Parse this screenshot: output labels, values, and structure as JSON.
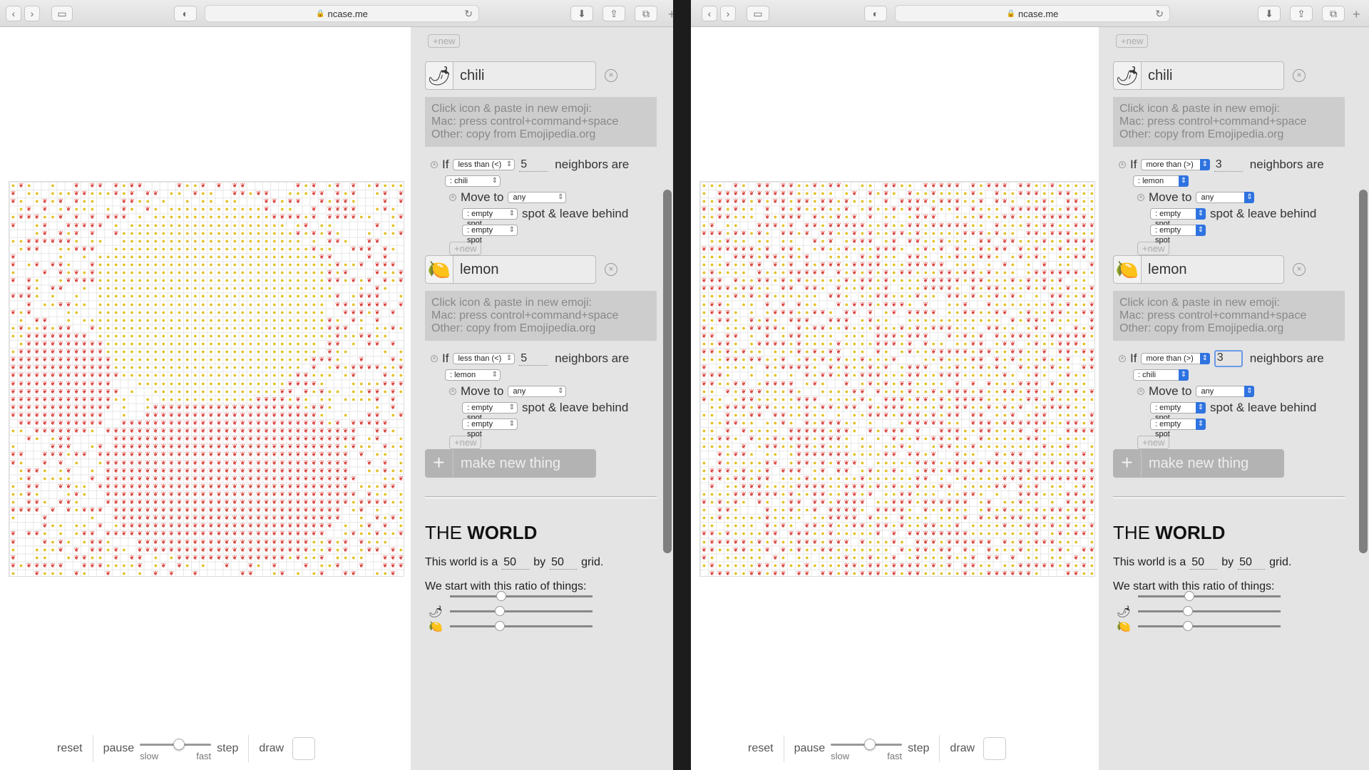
{
  "browser": {
    "url": "ncase.me",
    "lock_icon": "lock-icon",
    "reload_icon": "reload-icon"
  },
  "controls": {
    "reset": "reset",
    "pause": "pause",
    "slow": "slow",
    "fast": "fast",
    "step": "step",
    "draw": "draw",
    "speed_level": 0.55
  },
  "panes": [
    {
      "top_new": "+new",
      "things": [
        {
          "name": "chili",
          "emoji": "🌶",
          "hint_1": "Click icon & paste in new emoji:",
          "hint_2": "Mac: press control+command+space",
          "hint_3": "Other: copy from Emojipedia.org",
          "if_label": "If",
          "comparator": "less than (<)",
          "count": "5",
          "neighbors_label": "neighbors are",
          "neighbor_type": ": chili",
          "move_label": "Move to",
          "move_target": "any",
          "spot_select": ": empty spot",
          "leave_label": "spot & leave behind",
          "leave_select": ": empty spot",
          "inner_new": "+new",
          "outer_new": "+new"
        },
        {
          "name": "lemon",
          "emoji": "🍋",
          "hint_1": "Click icon & paste in new emoji:",
          "hint_2": "Mac: press control+command+space",
          "hint_3": "Other: copy from Emojipedia.org",
          "if_label": "If",
          "comparator": "less than (<)",
          "count": "5",
          "neighbors_label": "neighbors are",
          "neighbor_type": ": lemon",
          "move_label": "Move to",
          "move_target": "any",
          "spot_select": ": empty spot",
          "leave_label": "spot & leave behind",
          "leave_select": ": empty spot",
          "inner_new": "+new",
          "outer_new": "+new"
        }
      ],
      "make_new": "make new thing",
      "world_title_1": "THE ",
      "world_title_2": "WORLD",
      "world_line_a": "This world is a",
      "world_w": "50",
      "world_by": "by",
      "world_h": "50",
      "world_grid": "grid.",
      "ratio_label": "We start with this ratio of things:",
      "ratio_levels": [
        0.36,
        0.35,
        0.35
      ]
    },
    {
      "top_new": "+new",
      "things": [
        {
          "name": "chili",
          "emoji": "🌶",
          "hint_1": "Click icon & paste in new emoji:",
          "hint_2": "Mac: press control+command+space",
          "hint_3": "Other: copy from Emojipedia.org",
          "if_label": "If",
          "comparator": "more than (>)",
          "count": "3",
          "neighbors_label": "neighbors are",
          "neighbor_type": ": lemon",
          "move_label": "Move to",
          "move_target": "any",
          "spot_select": ": empty spot",
          "leave_label": "spot & leave behind",
          "leave_select": ": empty spot",
          "inner_new": "+new",
          "outer_new": "+new"
        },
        {
          "name": "lemon",
          "emoji": "🍋",
          "hint_1": "Click icon & paste in new emoji:",
          "hint_2": "Mac: press control+command+space",
          "hint_3": "Other: copy from Emojipedia.org",
          "if_label": "If",
          "comparator": "more than (>)",
          "count": "3",
          "neighbors_label": "neighbors are",
          "neighbor_type": ": chili",
          "move_label": "Move to",
          "move_target": "any",
          "spot_select": ": empty spot",
          "leave_label": "spot & leave behind",
          "leave_select": ": empty spot",
          "inner_new": "+new",
          "outer_new": "+new"
        }
      ],
      "make_new": "make new thing",
      "world_title_1": "THE ",
      "world_title_2": "WORLD",
      "world_line_a": "This world is a",
      "world_w": "50",
      "world_by": "by",
      "world_h": "50",
      "world_grid": "grid.",
      "ratio_label": "We start with this ratio of things:",
      "ratio_levels": [
        0.36,
        0.35,
        0.35
      ]
    }
  ],
  "colors": {
    "chili": "#d9423c",
    "lemon": "#e3c22a",
    "select_accent": "#2f73e0"
  }
}
